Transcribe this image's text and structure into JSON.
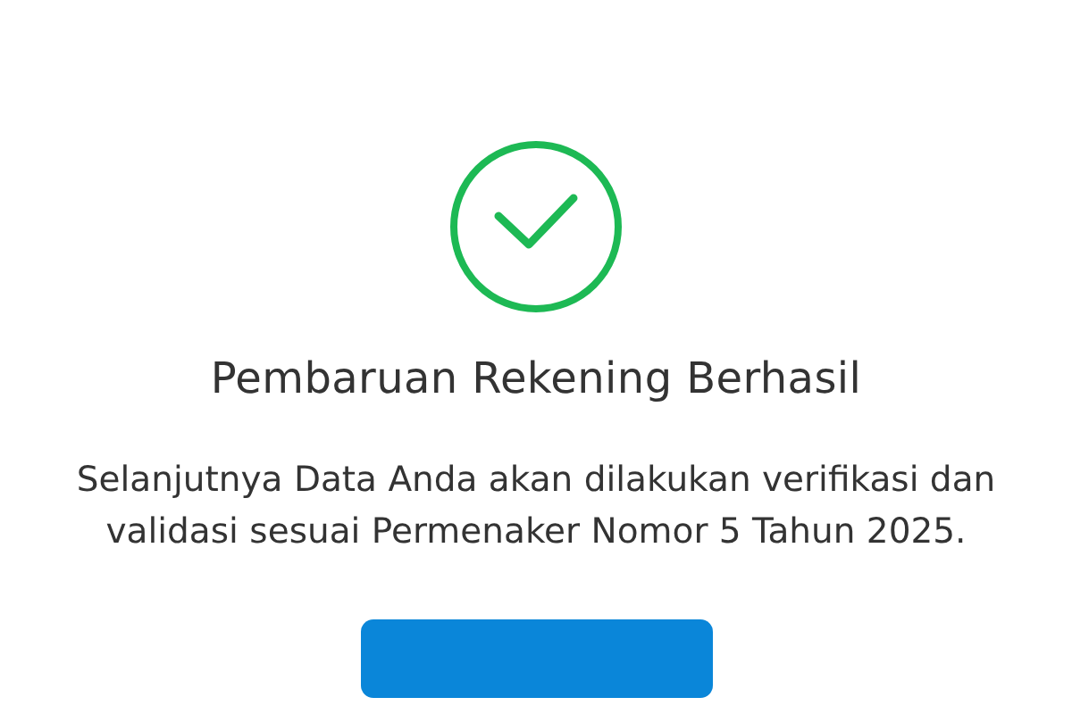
{
  "status": {
    "kind": "success"
  },
  "title": "Pembaruan Rekening Berhasil",
  "message": "Selanjutnya Data Anda akan dilakukan verifikasi dan validasi sesuai Permenaker Nomor 5 Tahun 2025.",
  "action_button": {
    "kind": "primary"
  }
}
